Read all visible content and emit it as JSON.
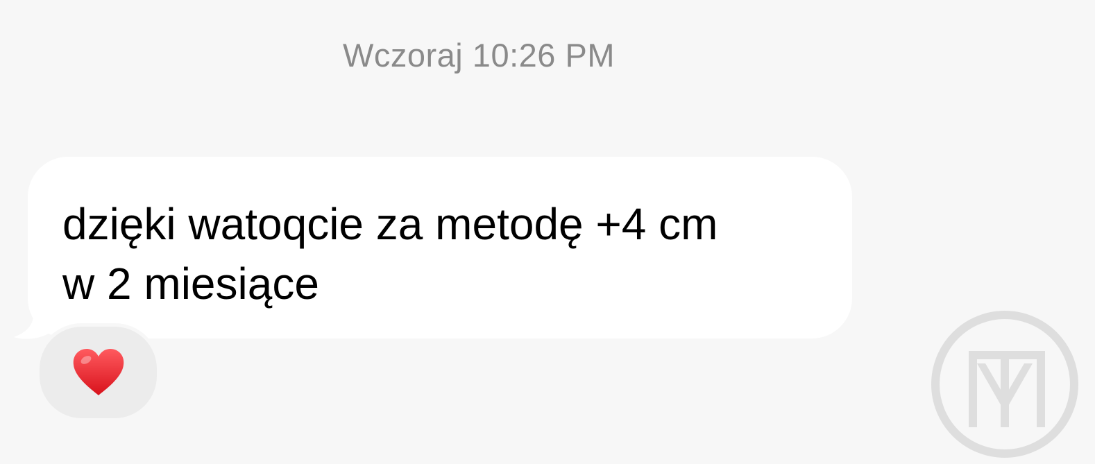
{
  "conversation": {
    "timestamp": "Wczoraj 10:26 PM",
    "message": {
      "text": "dzięki watoqcie za metodę +4 cm\nw 2 miesiące",
      "reaction": "heart-emoji"
    }
  },
  "colors": {
    "background": "#f7f7f7",
    "bubble": "#ffffff",
    "reaction_pill": "#ececec",
    "timestamp_text": "#8a8a8a",
    "heart": "#e8202a",
    "watermark": "#dedede"
  },
  "watermark": {
    "icon": "mt-monogram-logo"
  }
}
